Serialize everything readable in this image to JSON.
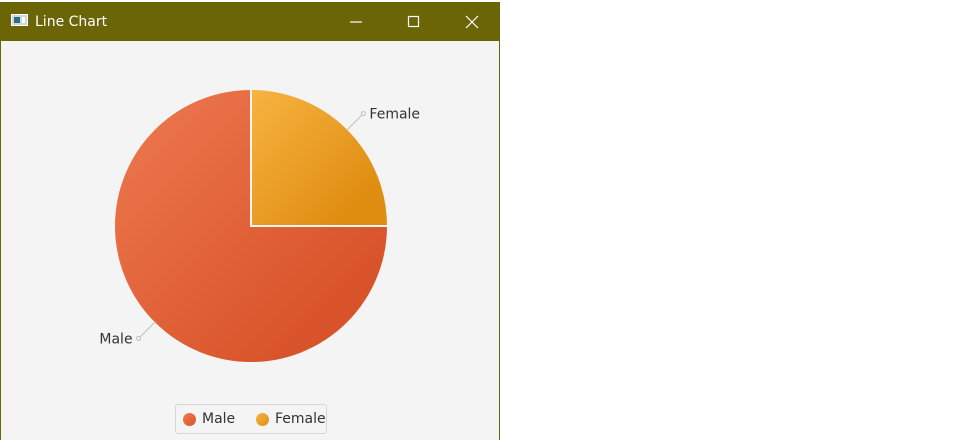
{
  "window": {
    "title": "Line Chart",
    "icon": "window-app-icon",
    "controls": [
      "minimize-icon",
      "maximize-icon",
      "close-icon"
    ],
    "titlebar_color": "#6b6508"
  },
  "chart_data": {
    "type": "pie",
    "slices": [
      {
        "label": "Male",
        "value": 75,
        "color_light": "#ee7a50",
        "color_dark": "#d9532a"
      },
      {
        "label": "Female",
        "value": 25,
        "color_light": "#f7b441",
        "color_dark": "#e08e12"
      }
    ],
    "legend": [
      "Male",
      "Female"
    ],
    "legend_placement": "bottom"
  },
  "legend": {
    "male": "Male",
    "female": "Female"
  }
}
